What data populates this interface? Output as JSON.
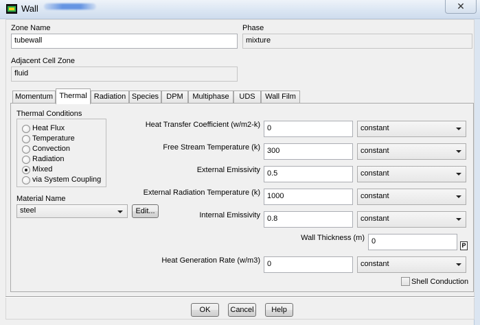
{
  "window": {
    "title": "Wall",
    "close_glyph": "✕"
  },
  "zone_name": {
    "label": "Zone Name",
    "value": "tubewall"
  },
  "phase": {
    "label": "Phase",
    "value": "mixture"
  },
  "adjacent_cell_zone": {
    "label": "Adjacent Cell Zone",
    "value": "fluid"
  },
  "tabs": [
    {
      "label": "Momentum",
      "active": false
    },
    {
      "label": "Thermal",
      "active": true
    },
    {
      "label": "Radiation",
      "active": false
    },
    {
      "label": "Species",
      "active": false
    },
    {
      "label": "DPM",
      "active": false
    },
    {
      "label": "Multiphase",
      "active": false
    },
    {
      "label": "UDS",
      "active": false
    },
    {
      "label": "Wall Film",
      "active": false
    }
  ],
  "thermal_conditions": {
    "label": "Thermal Conditions",
    "options": [
      "Heat Flux",
      "Temperature",
      "Convection",
      "Radiation",
      "Mixed",
      "via System Coupling"
    ],
    "selected": "Mixed"
  },
  "material": {
    "label": "Material Name",
    "value": "steel",
    "edit_label": "Edit..."
  },
  "fields": {
    "heat_transfer_coefficient": {
      "label": "Heat Transfer Coefficient (w/m2-k)",
      "value": "0",
      "method": "constant"
    },
    "free_stream_temperature": {
      "label": "Free Stream Temperature (k)",
      "value": "300",
      "method": "constant"
    },
    "external_emissivity": {
      "label": "External Emissivity",
      "value": "0.5",
      "method": "constant"
    },
    "external_radiation_temperature": {
      "label": "External Radiation Temperature (k)",
      "value": "1000",
      "method": "constant"
    },
    "internal_emissivity": {
      "label": "Internal Emissivity",
      "value": "0.8",
      "method": "constant"
    },
    "wall_thickness": {
      "label": "Wall Thickness (m)",
      "value": "0",
      "param_glyph": "P"
    },
    "heat_generation_rate": {
      "label": "Heat Generation Rate (w/m3)",
      "value": "0",
      "method": "constant"
    }
  },
  "shell_conduction": {
    "label": "Shell Conduction",
    "checked": false
  },
  "buttons": {
    "ok": "OK",
    "cancel": "Cancel",
    "help": "Help"
  },
  "colors": {
    "title_gradient_top": "#eef3f9",
    "title_gradient_bottom": "#cfdced",
    "dialog_bg": "#f0f0f0"
  },
  "icons": {
    "window": "fluent-window-icon",
    "combo": "dropdown-arrow-icon"
  }
}
